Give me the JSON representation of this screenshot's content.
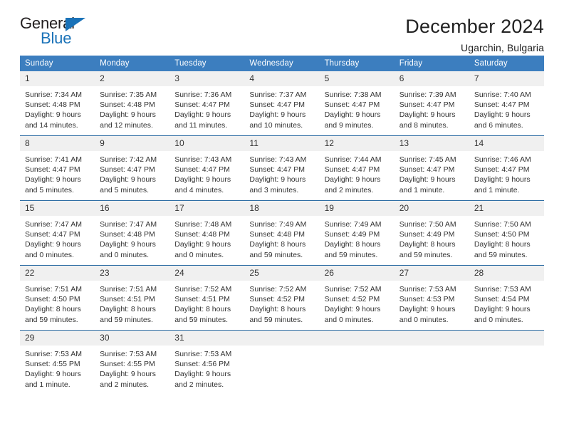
{
  "logo": {
    "word_one": "General",
    "word_two": "Blue",
    "triangle_icon": "blue-triangle-icon",
    "accent_color": "#1a72b8"
  },
  "header": {
    "title": "December 2024",
    "subtitle": "Ugarchin, Bulgaria"
  },
  "theme": {
    "header_row_bg": "#3c7ebf",
    "daynum_bg": "#f0f0f0",
    "row_border": "#2e6da4",
    "text": "#333333"
  },
  "weekday_headers": [
    "Sunday",
    "Monday",
    "Tuesday",
    "Wednesday",
    "Thursday",
    "Friday",
    "Saturday"
  ],
  "weeks": [
    [
      {
        "day": "1",
        "sunrise": "Sunrise: 7:34 AM",
        "sunset": "Sunset: 4:48 PM",
        "daylight_line1": "Daylight: 9 hours",
        "daylight_line2": "and 14 minutes."
      },
      {
        "day": "2",
        "sunrise": "Sunrise: 7:35 AM",
        "sunset": "Sunset: 4:48 PM",
        "daylight_line1": "Daylight: 9 hours",
        "daylight_line2": "and 12 minutes."
      },
      {
        "day": "3",
        "sunrise": "Sunrise: 7:36 AM",
        "sunset": "Sunset: 4:47 PM",
        "daylight_line1": "Daylight: 9 hours",
        "daylight_line2": "and 11 minutes."
      },
      {
        "day": "4",
        "sunrise": "Sunrise: 7:37 AM",
        "sunset": "Sunset: 4:47 PM",
        "daylight_line1": "Daylight: 9 hours",
        "daylight_line2": "and 10 minutes."
      },
      {
        "day": "5",
        "sunrise": "Sunrise: 7:38 AM",
        "sunset": "Sunset: 4:47 PM",
        "daylight_line1": "Daylight: 9 hours",
        "daylight_line2": "and 9 minutes."
      },
      {
        "day": "6",
        "sunrise": "Sunrise: 7:39 AM",
        "sunset": "Sunset: 4:47 PM",
        "daylight_line1": "Daylight: 9 hours",
        "daylight_line2": "and 8 minutes."
      },
      {
        "day": "7",
        "sunrise": "Sunrise: 7:40 AM",
        "sunset": "Sunset: 4:47 PM",
        "daylight_line1": "Daylight: 9 hours",
        "daylight_line2": "and 6 minutes."
      }
    ],
    [
      {
        "day": "8",
        "sunrise": "Sunrise: 7:41 AM",
        "sunset": "Sunset: 4:47 PM",
        "daylight_line1": "Daylight: 9 hours",
        "daylight_line2": "and 5 minutes."
      },
      {
        "day": "9",
        "sunrise": "Sunrise: 7:42 AM",
        "sunset": "Sunset: 4:47 PM",
        "daylight_line1": "Daylight: 9 hours",
        "daylight_line2": "and 5 minutes."
      },
      {
        "day": "10",
        "sunrise": "Sunrise: 7:43 AM",
        "sunset": "Sunset: 4:47 PM",
        "daylight_line1": "Daylight: 9 hours",
        "daylight_line2": "and 4 minutes."
      },
      {
        "day": "11",
        "sunrise": "Sunrise: 7:43 AM",
        "sunset": "Sunset: 4:47 PM",
        "daylight_line1": "Daylight: 9 hours",
        "daylight_line2": "and 3 minutes."
      },
      {
        "day": "12",
        "sunrise": "Sunrise: 7:44 AM",
        "sunset": "Sunset: 4:47 PM",
        "daylight_line1": "Daylight: 9 hours",
        "daylight_line2": "and 2 minutes."
      },
      {
        "day": "13",
        "sunrise": "Sunrise: 7:45 AM",
        "sunset": "Sunset: 4:47 PM",
        "daylight_line1": "Daylight: 9 hours",
        "daylight_line2": "and 1 minute."
      },
      {
        "day": "14",
        "sunrise": "Sunrise: 7:46 AM",
        "sunset": "Sunset: 4:47 PM",
        "daylight_line1": "Daylight: 9 hours",
        "daylight_line2": "and 1 minute."
      }
    ],
    [
      {
        "day": "15",
        "sunrise": "Sunrise: 7:47 AM",
        "sunset": "Sunset: 4:47 PM",
        "daylight_line1": "Daylight: 9 hours",
        "daylight_line2": "and 0 minutes."
      },
      {
        "day": "16",
        "sunrise": "Sunrise: 7:47 AM",
        "sunset": "Sunset: 4:48 PM",
        "daylight_line1": "Daylight: 9 hours",
        "daylight_line2": "and 0 minutes."
      },
      {
        "day": "17",
        "sunrise": "Sunrise: 7:48 AM",
        "sunset": "Sunset: 4:48 PM",
        "daylight_line1": "Daylight: 9 hours",
        "daylight_line2": "and 0 minutes."
      },
      {
        "day": "18",
        "sunrise": "Sunrise: 7:49 AM",
        "sunset": "Sunset: 4:48 PM",
        "daylight_line1": "Daylight: 8 hours",
        "daylight_line2": "and 59 minutes."
      },
      {
        "day": "19",
        "sunrise": "Sunrise: 7:49 AM",
        "sunset": "Sunset: 4:49 PM",
        "daylight_line1": "Daylight: 8 hours",
        "daylight_line2": "and 59 minutes."
      },
      {
        "day": "20",
        "sunrise": "Sunrise: 7:50 AM",
        "sunset": "Sunset: 4:49 PM",
        "daylight_line1": "Daylight: 8 hours",
        "daylight_line2": "and 59 minutes."
      },
      {
        "day": "21",
        "sunrise": "Sunrise: 7:50 AM",
        "sunset": "Sunset: 4:50 PM",
        "daylight_line1": "Daylight: 8 hours",
        "daylight_line2": "and 59 minutes."
      }
    ],
    [
      {
        "day": "22",
        "sunrise": "Sunrise: 7:51 AM",
        "sunset": "Sunset: 4:50 PM",
        "daylight_line1": "Daylight: 8 hours",
        "daylight_line2": "and 59 minutes."
      },
      {
        "day": "23",
        "sunrise": "Sunrise: 7:51 AM",
        "sunset": "Sunset: 4:51 PM",
        "daylight_line1": "Daylight: 8 hours",
        "daylight_line2": "and 59 minutes."
      },
      {
        "day": "24",
        "sunrise": "Sunrise: 7:52 AM",
        "sunset": "Sunset: 4:51 PM",
        "daylight_line1": "Daylight: 8 hours",
        "daylight_line2": "and 59 minutes."
      },
      {
        "day": "25",
        "sunrise": "Sunrise: 7:52 AM",
        "sunset": "Sunset: 4:52 PM",
        "daylight_line1": "Daylight: 8 hours",
        "daylight_line2": "and 59 minutes."
      },
      {
        "day": "26",
        "sunrise": "Sunrise: 7:52 AM",
        "sunset": "Sunset: 4:52 PM",
        "daylight_line1": "Daylight: 9 hours",
        "daylight_line2": "and 0 minutes."
      },
      {
        "day": "27",
        "sunrise": "Sunrise: 7:53 AM",
        "sunset": "Sunset: 4:53 PM",
        "daylight_line1": "Daylight: 9 hours",
        "daylight_line2": "and 0 minutes."
      },
      {
        "day": "28",
        "sunrise": "Sunrise: 7:53 AM",
        "sunset": "Sunset: 4:54 PM",
        "daylight_line1": "Daylight: 9 hours",
        "daylight_line2": "and 0 minutes."
      }
    ],
    [
      {
        "day": "29",
        "sunrise": "Sunrise: 7:53 AM",
        "sunset": "Sunset: 4:55 PM",
        "daylight_line1": "Daylight: 9 hours",
        "daylight_line2": "and 1 minute."
      },
      {
        "day": "30",
        "sunrise": "Sunrise: 7:53 AM",
        "sunset": "Sunset: 4:55 PM",
        "daylight_line1": "Daylight: 9 hours",
        "daylight_line2": "and 2 minutes."
      },
      {
        "day": "31",
        "sunrise": "Sunrise: 7:53 AM",
        "sunset": "Sunset: 4:56 PM",
        "daylight_line1": "Daylight: 9 hours",
        "daylight_line2": "and 2 minutes."
      },
      {
        "day": "",
        "sunrise": "",
        "sunset": "",
        "daylight_line1": "",
        "daylight_line2": ""
      },
      {
        "day": "",
        "sunrise": "",
        "sunset": "",
        "daylight_line1": "",
        "daylight_line2": ""
      },
      {
        "day": "",
        "sunrise": "",
        "sunset": "",
        "daylight_line1": "",
        "daylight_line2": ""
      },
      {
        "day": "",
        "sunrise": "",
        "sunset": "",
        "daylight_line1": "",
        "daylight_line2": ""
      }
    ]
  ]
}
